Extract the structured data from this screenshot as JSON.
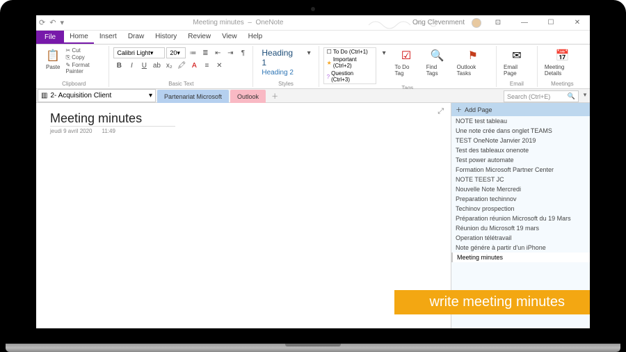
{
  "titlebar": {
    "doc_title": "Meeting minutes",
    "app_name": "OneNote",
    "user_name": "Ong Clevenment"
  },
  "tabs": {
    "file": "File",
    "items": [
      "Home",
      "Insert",
      "Draw",
      "History",
      "Review",
      "View",
      "Help"
    ],
    "active_index": 0
  },
  "ribbon": {
    "clipboard": {
      "paste": "Paste",
      "cut": "Cut",
      "copy": "Copy",
      "painter": "Format Painter",
      "label": "Clipboard"
    },
    "font": {
      "name": "Calibri Light",
      "size": "20",
      "label": "Basic Text"
    },
    "styles": {
      "h1": "Heading 1",
      "h2": "Heading 2",
      "label": "Styles"
    },
    "tags": {
      "todo": "To Do (Ctrl+1)",
      "important": "Important (Ctrl+2)",
      "question": "Question (Ctrl+3)",
      "todo_tag": "To Do Tag",
      "find": "Find Tags",
      "outlook": "Outlook Tasks",
      "label": "Tags"
    },
    "email": {
      "btn": "Email Page",
      "label": "Email"
    },
    "meetings": {
      "btn": "Meeting Details",
      "label": "Meetings"
    }
  },
  "sections": {
    "notebook": "2- Acquisition Client",
    "tabs": [
      "Partenariat Microsoft",
      "Outlook"
    ],
    "search_placeholder": "Search (Ctrl+E)"
  },
  "page": {
    "title": "Meeting minutes",
    "date": "jeudi 9 avril 2020",
    "time": "11:49"
  },
  "page_pane": {
    "add": "Add Page",
    "pages": [
      "NOTE test tableau",
      "Une note crée dans onglet TEAMS",
      "TEST OneNote Janvier 2019",
      "Test des tableaux onenote",
      "Test power automate",
      "Formation Microsoft Partner Center",
      "NOTE TEEST JC",
      "Nouvelle Note Mercredi",
      "Preparation techinnov",
      "Techinov prospection",
      "Préparation réunion Microsoft du 19 Mars",
      "Réunion du Microsoft 19 mars",
      "Operation télétravail",
      "Note génére à partir d'un iPhone",
      "Meeting minutes"
    ],
    "selected_index": 14
  },
  "toast": "write meeting minutes"
}
